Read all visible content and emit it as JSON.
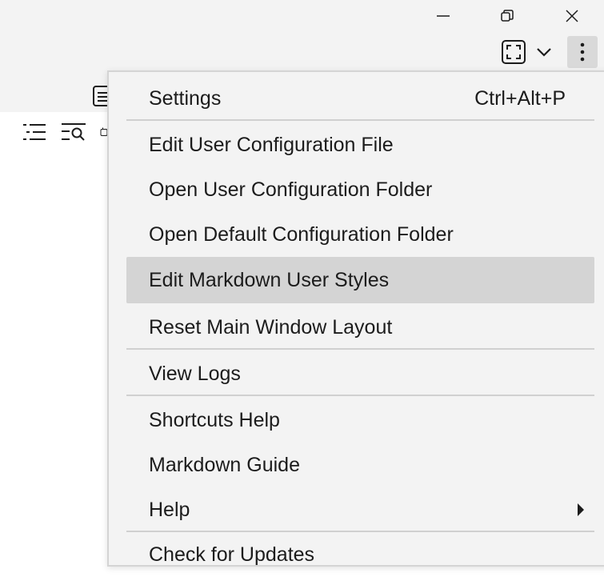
{
  "window_controls": {
    "minimize_icon": "minimize-icon",
    "restore_icon": "restore-icon",
    "close_icon": "close-icon"
  },
  "toolbar": {
    "fullscreen_icon": "fullscreen-icon",
    "dropdown_icon": "chevron-down-icon",
    "more_icon": "more-vertical-icon"
  },
  "sidebar": {
    "icons": [
      "list-icon",
      "search-list-icon",
      "plugin-icon",
      "table-icon"
    ]
  },
  "menu": {
    "items": [
      {
        "label": "Settings",
        "shortcut": "Ctrl+Alt+P"
      },
      {
        "label": "Edit User Configuration File"
      },
      {
        "label": "Open User Configuration Folder"
      },
      {
        "label": "Open Default Configuration Folder"
      },
      {
        "label": "Edit Markdown User Styles",
        "highlighted": true
      },
      {
        "label": "Reset Main Window Layout"
      },
      {
        "label": "View Logs"
      },
      {
        "label": "Shortcuts Help"
      },
      {
        "label": "Markdown Guide"
      },
      {
        "label": "Help",
        "submenu": true
      },
      {
        "label": "Check for Updates"
      }
    ]
  },
  "colors": {
    "chrome_background": "#f3f3f3",
    "menu_highlight": "#d4d4d4",
    "text": "#1c1c1c"
  }
}
